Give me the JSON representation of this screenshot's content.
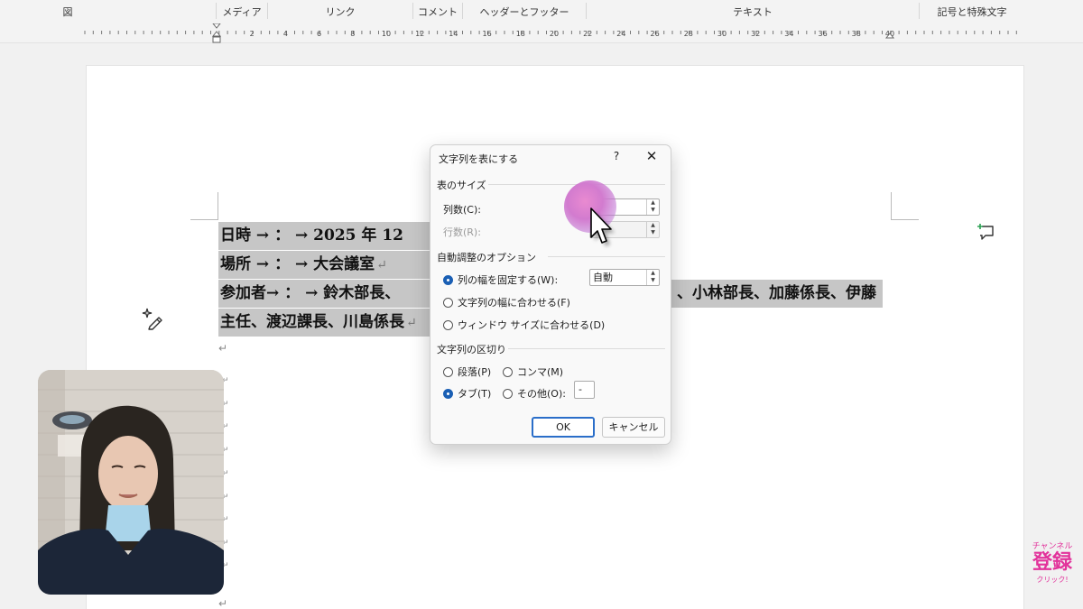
{
  "ribbon": {
    "groups": [
      {
        "label": "図"
      },
      {
        "label": "メディア"
      },
      {
        "label": "リンク"
      },
      {
        "label": "コメント"
      },
      {
        "label": "ヘッダーとフッター"
      },
      {
        "label": "テキスト"
      },
      {
        "label": "記号と特殊文字"
      }
    ]
  },
  "ruler": {
    "numbers": [
      "2",
      "4",
      "6",
      "8",
      "10",
      "12",
      "14",
      "16",
      "18",
      "20",
      "22",
      "24",
      "26",
      "28",
      "30",
      "32",
      "34",
      "36",
      "38",
      "40"
    ]
  },
  "document": {
    "lines": [
      {
        "text": "日時 → ： → 2025 年 12",
        "mark": "",
        "shaded_to_edge": false
      },
      {
        "text": "場所 → ： → 大会議室",
        "mark": "↵",
        "shaded_to_edge": false
      },
      {
        "text": "参加者→ ： → 鈴木部長、",
        "tail": "、小林部長、加藤係長、伊藤",
        "mark": "",
        "shaded_to_edge": true
      },
      {
        "text": "主任、渡辺課長、川島係長",
        "mark": "↵",
        "shaded_to_edge": false
      }
    ],
    "paragraph_mark": "↵"
  },
  "dialog": {
    "title": "文字列を表にする",
    "help": "?",
    "close": "✕",
    "table_size": {
      "label": "表のサイズ",
      "columns_label": "列数(C):",
      "columns_value": "3",
      "rows_label": "行数(R):",
      "rows_value": ""
    },
    "autofit": {
      "label": "自動調整のオプション",
      "fixed_width_label": "列の幅を固定する(W):",
      "fixed_width_value": "自動",
      "fit_contents_label": "文字列の幅に合わせる(F)",
      "fit_window_label": "ウィンドウ サイズに合わせる(D)",
      "selected": "fixed_width"
    },
    "separator": {
      "label": "文字列の区切り",
      "paragraph_label": "段落(P)",
      "comma_label": "コンマ(M)",
      "tab_label": "タブ(T)",
      "other_label": "その他(O):",
      "other_value": "-",
      "selected": "tab"
    },
    "ok_label": "OK",
    "cancel_label": "キャンセル"
  },
  "badge": {
    "top": "チャンネル",
    "main": "登録",
    "bottom": "クリック!"
  },
  "colors": {
    "selection": "#c6c6c6",
    "accent": "#1a5fb4",
    "badge": "#e2339b",
    "highlight": "#d27bcf"
  }
}
